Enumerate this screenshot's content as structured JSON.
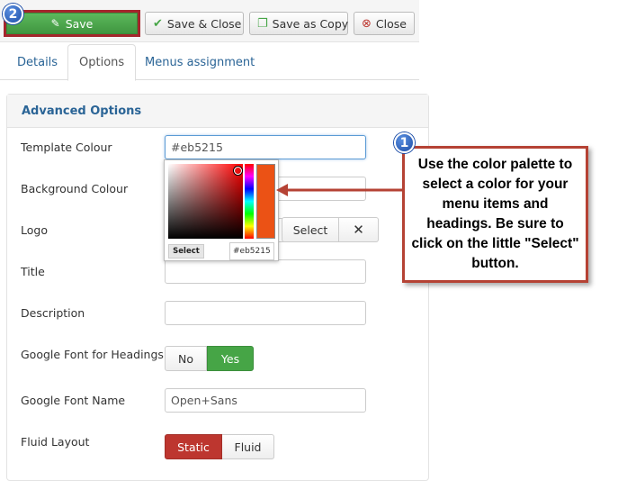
{
  "toolbar": {
    "save_label": "Save",
    "save_close_label": "Save & Close",
    "save_copy_label": "Save as Copy",
    "close_label": "Close"
  },
  "badges": {
    "save_step": "2",
    "palette_step": "1"
  },
  "tabs": [
    {
      "label": "Details",
      "active": false
    },
    {
      "label": "Options",
      "active": true
    },
    {
      "label": "Menus assignment",
      "active": false
    }
  ],
  "panel": {
    "title": "Advanced Options"
  },
  "fields": {
    "template_colour": {
      "label": "Template Colour",
      "value": "#eb5215"
    },
    "background_colour": {
      "label": "Background Colour",
      "value": ""
    },
    "logo": {
      "label": "Logo",
      "select_label": "Select",
      "clear_label": "✕"
    },
    "title": {
      "label": "Title",
      "value": ""
    },
    "description": {
      "label": "Description",
      "value": ""
    },
    "google_font_headings": {
      "label": "Google Font for Headings",
      "options": [
        "No",
        "Yes"
      ],
      "selected": "Yes"
    },
    "google_font_name": {
      "label": "Google Font Name",
      "value": "Open+Sans"
    },
    "fluid_layout": {
      "label": "Fluid Layout",
      "options": [
        "Static",
        "Fluid"
      ],
      "selected": "Static"
    }
  },
  "color_picker": {
    "select_label": "Select",
    "hex_value": "#eb5215",
    "current_color": "#eb5215"
  },
  "callout": {
    "text": "Use the color palette to select a color for your menu items and headings. Be sure to click on the little \"Select\" button."
  },
  "colors": {
    "accent_green": "#46a546",
    "accent_red": "#bd362f",
    "callout_border": "#b54234",
    "link_blue": "#2a6496"
  }
}
